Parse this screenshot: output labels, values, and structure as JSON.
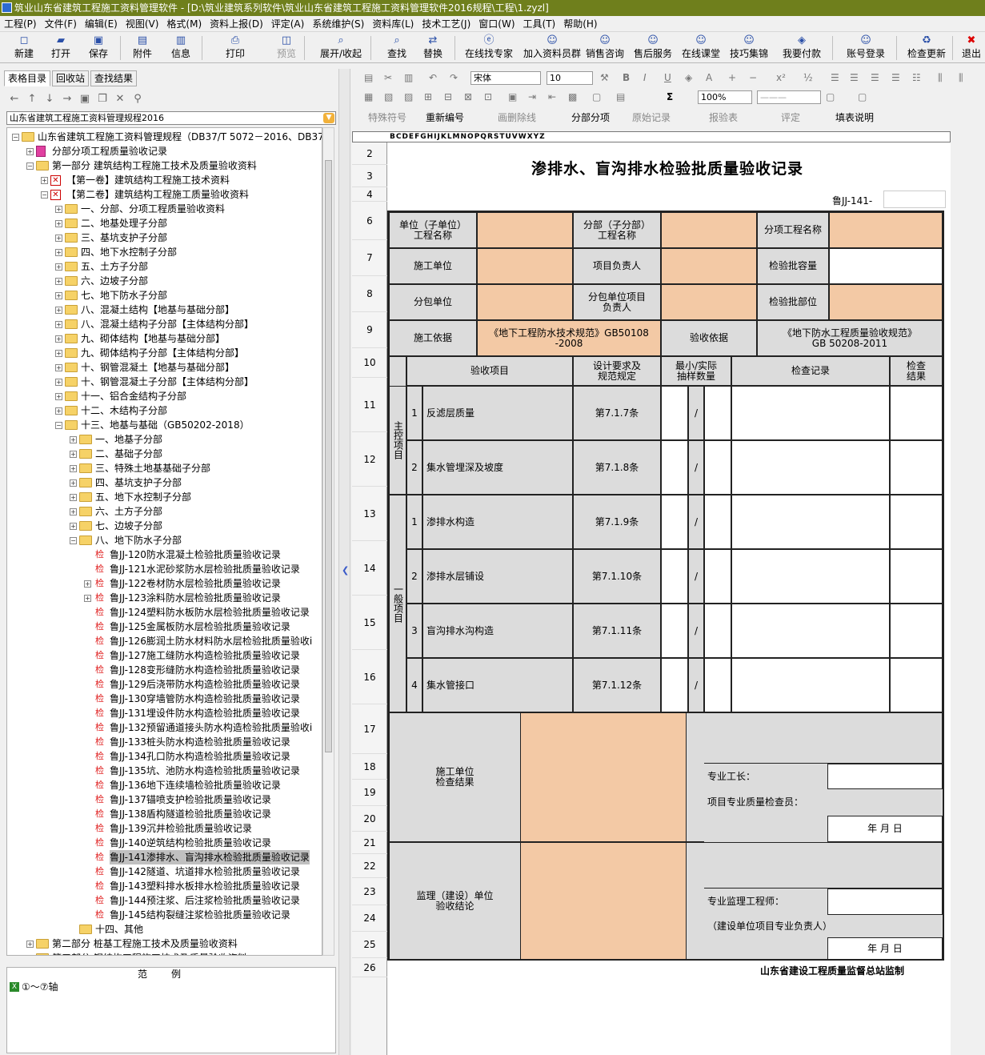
{
  "window": {
    "title": "筑业山东省建筑工程施工资料管理软件 - [D:\\筑业建筑系列软件\\筑业山东省建筑工程施工资料管理软件2016规程\\工程\\1.zyzl]"
  },
  "menu": [
    "工程(P)",
    "文件(F)",
    "编辑(E)",
    "视图(V)",
    "格式(M)",
    "资料上报(D)",
    "评定(A)",
    "系统维护(S)",
    "资料库(L)",
    "技术工艺(J)",
    "窗口(W)",
    "工具(T)",
    "帮助(H)"
  ],
  "toolbar": [
    "新建",
    "打开",
    "保存",
    "附件",
    "信息",
    "打印",
    "预览",
    "展开/收起",
    "查找",
    "替换",
    "在线找专家",
    "加入资料员群",
    "销售咨询",
    "售后服务",
    "在线课堂",
    "技巧集锦",
    "我要付款",
    "账号登录",
    "检查更新",
    "退出"
  ],
  "left": {
    "tabs": [
      "表格目录",
      "回收站",
      "查找结果"
    ],
    "dropdown_value": "山东省建筑工程施工资料管理规程2016",
    "tree": [
      {
        "level": 0,
        "icon": "folder",
        "expand": "-",
        "text": "山东省建筑工程施工资料管理规程（DB37/T 5072－2016、DB37/T 5"
      },
      {
        "level": 1,
        "icon": "page",
        "expand": "+",
        "text": "分部分项工程质量验收记录"
      },
      {
        "level": 1,
        "icon": "folder",
        "expand": "-",
        "text": "第一部分   建筑结构工程施工技术及质量验收资料"
      },
      {
        "level": 2,
        "icon": "check",
        "expand": "+",
        "text": "【第一卷】建筑结构工程施工技术资料"
      },
      {
        "level": 2,
        "icon": "check",
        "expand": "-",
        "text": "【第二卷】建筑结构工程施工质量验收资料"
      },
      {
        "level": 3,
        "icon": "folder",
        "expand": "+",
        "text": "一、分部、分项工程质量验收资料"
      },
      {
        "level": 3,
        "icon": "folder",
        "expand": "+",
        "text": "二、地基处理子分部"
      },
      {
        "level": 3,
        "icon": "folder",
        "expand": "+",
        "text": "三、基坑支护子分部"
      },
      {
        "level": 3,
        "icon": "folder",
        "expand": "+",
        "text": "四、地下水控制子分部"
      },
      {
        "level": 3,
        "icon": "folder",
        "expand": "+",
        "text": "五、土方子分部"
      },
      {
        "level": 3,
        "icon": "folder",
        "expand": "+",
        "text": "六、边坡子分部"
      },
      {
        "level": 3,
        "icon": "folder",
        "expand": "+",
        "text": "七、地下防水子分部"
      },
      {
        "level": 3,
        "icon": "folder",
        "expand": "+",
        "text": "八、混凝土结构【地基与基础分部】"
      },
      {
        "level": 3,
        "icon": "folder",
        "expand": "+",
        "text": "八、混凝土结构子分部【主体结构分部】"
      },
      {
        "level": 3,
        "icon": "folder",
        "expand": "+",
        "text": "九、砌体结构【地基与基础分部】"
      },
      {
        "level": 3,
        "icon": "folder",
        "expand": "+",
        "text": "九、砌体结构子分部【主体结构分部】"
      },
      {
        "level": 3,
        "icon": "folder",
        "expand": "+",
        "text": "十、钢管混凝土【地基与基础分部】"
      },
      {
        "level": 3,
        "icon": "folder",
        "expand": "+",
        "text": "十、钢管混凝土子分部【主体结构分部】"
      },
      {
        "level": 3,
        "icon": "folder",
        "expand": "+",
        "text": "十一、铝合金结构子分部"
      },
      {
        "level": 3,
        "icon": "folder",
        "expand": "+",
        "text": "十二、木结构子分部"
      },
      {
        "level": 3,
        "icon": "folder",
        "expand": "-",
        "text": "十三、地基与基础（GB50202-2018）"
      },
      {
        "level": 4,
        "icon": "folder",
        "expand": "+",
        "text": "一、地基子分部"
      },
      {
        "level": 4,
        "icon": "folder",
        "expand": "+",
        "text": "二、基础子分部"
      },
      {
        "level": 4,
        "icon": "folder",
        "expand": "+",
        "text": "三、特殊土地基基础子分部"
      },
      {
        "level": 4,
        "icon": "folder",
        "expand": "+",
        "text": "四、基坑支护子分部"
      },
      {
        "level": 4,
        "icon": "folder",
        "expand": "+",
        "text": "五、地下水控制子分部"
      },
      {
        "level": 4,
        "icon": "folder",
        "expand": "+",
        "text": "六、土方子分部"
      },
      {
        "level": 4,
        "icon": "folder",
        "expand": "+",
        "text": "七、边坡子分部"
      },
      {
        "level": 4,
        "icon": "folder",
        "expand": "-",
        "text": "八、地下防水子分部"
      },
      {
        "level": 5,
        "icon": "jian",
        "expand": "",
        "text": "鲁JJ-120防水混凝土检验批质量验收记录"
      },
      {
        "level": 5,
        "icon": "jian",
        "expand": "",
        "text": "鲁JJ-121水泥砂浆防水层检验批质量验收记录"
      },
      {
        "level": 5,
        "icon": "jian",
        "expand": "+",
        "text": "鲁JJ-122卷材防水层检验批质量验收记录"
      },
      {
        "level": 5,
        "icon": "jian",
        "expand": "+",
        "text": "鲁JJ-123涂料防水层检验批质量验收记录"
      },
      {
        "level": 5,
        "icon": "jian",
        "expand": "",
        "text": "鲁JJ-124塑料防水板防水层检验批质量验收记录"
      },
      {
        "level": 5,
        "icon": "jian",
        "expand": "",
        "text": "鲁JJ-125金属板防水层检验批质量验收记录"
      },
      {
        "level": 5,
        "icon": "jian",
        "expand": "",
        "text": "鲁JJ-126膨润土防水材料防水层检验批质量验收i"
      },
      {
        "level": 5,
        "icon": "jian",
        "expand": "",
        "text": "鲁JJ-127施工缝防水构造检验批质量验收记录"
      },
      {
        "level": 5,
        "icon": "jian",
        "expand": "",
        "text": "鲁JJ-128变形缝防水构造检验批质量验收记录"
      },
      {
        "level": 5,
        "icon": "jian",
        "expand": "",
        "text": "鲁JJ-129后浇带防水构造检验批质量验收记录"
      },
      {
        "level": 5,
        "icon": "jian",
        "expand": "",
        "text": "鲁JJ-130穿墙管防水构造检验批质量验收记录"
      },
      {
        "level": 5,
        "icon": "jian",
        "expand": "",
        "text": "鲁JJ-131埋设件防水构造检验批质量验收记录"
      },
      {
        "level": 5,
        "icon": "jian",
        "expand": "",
        "text": "鲁JJ-132预留通道接头防水构造检验批质量验收i"
      },
      {
        "level": 5,
        "icon": "jian",
        "expand": "",
        "text": "鲁JJ-133桩头防水构造检验批质量验收记录"
      },
      {
        "level": 5,
        "icon": "jian",
        "expand": "",
        "text": "鲁JJ-134孔口防水构造检验批质量验收记录"
      },
      {
        "level": 5,
        "icon": "jian",
        "expand": "",
        "text": "鲁JJ-135坑、池防水构造检验批质量验收记录"
      },
      {
        "level": 5,
        "icon": "jian",
        "expand": "",
        "text": "鲁JJ-136地下连续墙检验批质量验收记录"
      },
      {
        "level": 5,
        "icon": "jian",
        "expand": "",
        "text": "鲁JJ-137锚喷支护检验批质量验收记录"
      },
      {
        "level": 5,
        "icon": "jian",
        "expand": "",
        "text": "鲁JJ-138盾构隧道检验批质量验收记录"
      },
      {
        "level": 5,
        "icon": "jian",
        "expand": "",
        "text": "鲁JJ-139沉井检验批质量验收记录"
      },
      {
        "level": 5,
        "icon": "jian",
        "expand": "",
        "text": "鲁JJ-140逆筑结构检验批质量验收记录"
      },
      {
        "level": 5,
        "icon": "jian",
        "expand": "",
        "text": "鲁JJ-141渗排水、盲沟排水检验批质量验收记录",
        "selected": true
      },
      {
        "level": 5,
        "icon": "jian",
        "expand": "",
        "text": "鲁JJ-142隧道、坑道排水检验批质量验收记录"
      },
      {
        "level": 5,
        "icon": "jian",
        "expand": "",
        "text": "鲁JJ-143塑料排水板排水检验批质量验收记录"
      },
      {
        "level": 5,
        "icon": "jian",
        "expand": "",
        "text": "鲁JJ-144预注浆、后注浆检验批质量验收记录"
      },
      {
        "level": 5,
        "icon": "jian",
        "expand": "",
        "text": "鲁JJ-145结构裂缝注浆检验批质量验收记录"
      },
      {
        "level": 4,
        "icon": "folder",
        "expand": "",
        "text": "十四、其他"
      },
      {
        "level": 1,
        "icon": "folder",
        "expand": "+",
        "text": "第二部分   桩基工程施工技术及质量验收资料"
      },
      {
        "level": 1,
        "icon": "folder",
        "expand": "+",
        "text": "第三部分   钢结构工程施工技术及质量验收资料"
      }
    ],
    "fanli_header": "范例",
    "fanli_items": [
      "①～⑦轴"
    ]
  },
  "fmt": {
    "font": "宋体",
    "size": "10",
    "zoom": "100%",
    "toolbar3": [
      "特殊符号",
      "重新编号",
      "画删除线",
      "分部分项",
      "原始记录",
      "报验表",
      "评定",
      "填表说明"
    ]
  },
  "colheader": "BCDEFGHIJKLMNOPQRSTUVWXYZ",
  "rows": [
    "2",
    "3",
    "4",
    "6",
    "7",
    "8",
    "9",
    "10",
    "11",
    "12",
    "13",
    "14",
    "15",
    "16",
    "17",
    "18",
    "19",
    "20",
    "21",
    "22",
    "23",
    "24",
    "25",
    "26"
  ],
  "doc": {
    "title": "渗排水、盲沟排水检验批质量验收记录",
    "code": "鲁JJ-141-",
    "unit_label": "单位（子单位）\n工程名称",
    "subdiv_label": "分部（子分部）\n工程名称",
    "item_label": "分项工程名称",
    "contractor_label": "施工单位",
    "pm_label": "项目负责人",
    "capacity_label": "检验批容量",
    "sub_label": "分包单位",
    "sub_pm_label": "分包单位项目\n负责人",
    "part_label": "检验批部位",
    "basis_label": "施工依据",
    "basis_value": "《地下工程防水技术规范》GB50108\n-2008",
    "accept_basis_label": "验收依据",
    "accept_basis_value": "《地下防水工程质量验收规范》\nGB 50208-2011",
    "h_item": "验收项目",
    "h_req": "设计要求及\n规范规定",
    "h_sample": "最小/实际\n抽样数量",
    "h_record": "检查记录",
    "h_result": "检查\n结果",
    "main_label": "主控项目",
    "general_label": "一般项目",
    "items": [
      {
        "no": "1",
        "name": "反滤层质量",
        "clause": "第7.1.7条",
        "slash": "/"
      },
      {
        "no": "2",
        "name": "集水管埋深及坡度",
        "clause": "第7.1.8条",
        "slash": "/"
      },
      {
        "no": "1",
        "name": "渗排水构造",
        "clause": "第7.1.9条",
        "slash": "/"
      },
      {
        "no": "2",
        "name": "渗排水层铺设",
        "clause": "第7.1.10条",
        "slash": "/"
      },
      {
        "no": "3",
        "name": "盲沟排水沟构造",
        "clause": "第7.1.11条",
        "slash": "/"
      },
      {
        "no": "4",
        "name": "集水管接口",
        "clause": "第7.1.12条",
        "slash": "/"
      }
    ],
    "contractor_check": "施工单位\n检查结果",
    "foreman": "专业工长：",
    "inspector": "项目专业质量检查员：",
    "date": "年  月  日",
    "supervisor_conclusion": "监理（建设）单位\n验收结论",
    "supervisor": "专业监理工程师：",
    "owner": "（建设单位项目专业负责人）",
    "footer": "山东省建设工程质量监督总站监制"
  }
}
